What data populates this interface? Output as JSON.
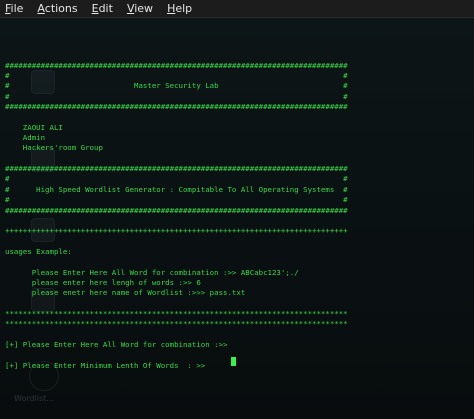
{
  "menu": {
    "items": [
      {
        "label": "File",
        "underline": "F",
        "rest": "ile"
      },
      {
        "label": "Actions",
        "underline": "A",
        "rest": "ctions"
      },
      {
        "label": "Edit",
        "underline": "E",
        "rest": "dit"
      },
      {
        "label": "View",
        "underline": "V",
        "rest": "iew"
      },
      {
        "label": "Help",
        "underline": "H",
        "rest": "elp"
      }
    ]
  },
  "terminal": {
    "lines": [
      "",
      "",
      "#############################################################################",
      "#                                                                           #",
      "#                            Master Security Lab                            #",
      "#                                                                           #",
      "#############################################################################",
      "",
      "    ZAOUI ALI",
      "    Admin",
      "    Hackers'room Group",
      "",
      "#############################################################################",
      "#                                                                           #",
      "#      High Speed Wordlist Generator : Compitable To All Operating Systems  #",
      "#                                                                           #",
      "#############################################################################",
      "",
      "+++++++++++++++++++++++++++++++++++++++++++++++++++++++++++++++++++++++++++++",
      "",
      "usages Example:",
      "",
      "      Please Enter Here All Word for combination :>> ABCabc123';./",
      "      please enter here lengh of words :>> 6",
      "      please enetr here name of Wordlist :>>> pass.txt",
      "",
      "*****************************************************************************",
      "*****************************************************************************",
      "",
      "[+] Please Enter Here All Word for combination :>>",
      "",
      "[+] Please Enter Minimum Lenth Of Words  : >>"
    ],
    "text_color": "#36d94a",
    "background": "#0b1214"
  },
  "desktop": {
    "label": "Wordlist..."
  }
}
